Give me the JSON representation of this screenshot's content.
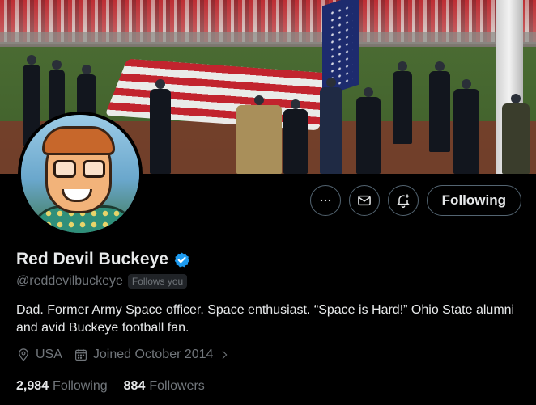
{
  "profile": {
    "display_name": "Red Devil Buckeye",
    "handle": "@reddevilbuckeye",
    "follows_you_badge": "Follows you",
    "verified_icon": "verified-badge-icon",
    "bio": "Dad. Former Army Space officer. Space enthusiast. “Space is Hard!” Ohio State alumni and avid Buckeye football fan.",
    "location": "USA",
    "joined": "Joined October 2014",
    "following_count": "2,984",
    "following_label": "Following",
    "followers_count": "884",
    "followers_label": "Followers"
  },
  "actions": {
    "more_icon": "more-icon",
    "message_icon": "message-icon",
    "notify_icon": "notification-bell-icon",
    "follow_label": "Following"
  },
  "colors": {
    "background": "#000000",
    "primary_text": "#e7e9ea",
    "secondary_text": "#71767b",
    "border": "#536471",
    "verified_blue": "#1d9bf0"
  }
}
